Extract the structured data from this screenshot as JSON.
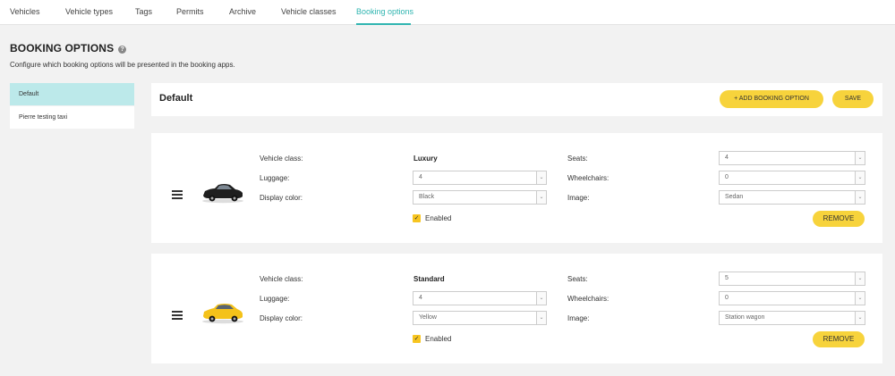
{
  "nav": {
    "tabs": [
      {
        "label": "Vehicles"
      },
      {
        "label": "Vehicle types"
      },
      {
        "label": "Tags"
      },
      {
        "label": "Permits"
      },
      {
        "label": "Archive"
      },
      {
        "label": "Vehicle classes"
      },
      {
        "label": "Booking options"
      }
    ],
    "active": "Booking options"
  },
  "page": {
    "title": "BOOKING OPTIONS",
    "help_glyph": "?",
    "subtitle": "Configure which booking options will be presented in the booking apps."
  },
  "sidebar": {
    "items": [
      {
        "label": "Default"
      },
      {
        "label": "Pierre testing taxi"
      }
    ]
  },
  "header": {
    "title": "Default",
    "add_label": "+ ADD BOOKING OPTION",
    "save_label": "SAVE"
  },
  "labels": {
    "vehicle_class": "Vehicle class:",
    "luggage": "Luggage:",
    "display_color": "Display color:",
    "seats": "Seats:",
    "wheelchairs": "Wheelchairs:",
    "image": "Image:",
    "enabled": "Enabled",
    "remove": "REMOVE",
    "arrow": "⌄",
    "check": "✓"
  },
  "options": [
    {
      "vehicle_class": "Luxury",
      "luggage": "4",
      "display_color": "Black",
      "seats": "4",
      "wheelchairs": "0",
      "image": "Sedan",
      "enabled": true,
      "car_color": "#1f1f1f"
    },
    {
      "vehicle_class": "Standard",
      "luggage": "4",
      "display_color": "Yellow",
      "seats": "5",
      "wheelchairs": "0",
      "image": "Station wagon",
      "enabled": true,
      "car_color": "#f4c21a"
    }
  ],
  "colors": {
    "accent": "#2fb5b0",
    "button": "#f7d33c",
    "active_side": "#bce9ea"
  }
}
